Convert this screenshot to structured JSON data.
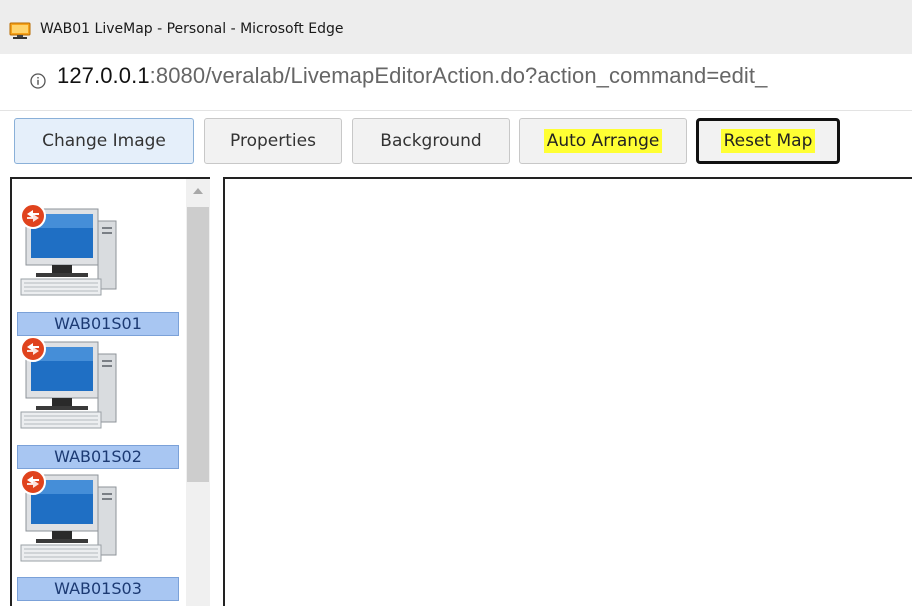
{
  "window": {
    "title": "WAB01 LiveMap - Personal - Microsoft Edge"
  },
  "addressbar": {
    "host": "127.0.0.1",
    "rest": ":8080/veralab/LivemapEditorAction.do?action_command=edit_"
  },
  "toolbar": {
    "change_image": "Change Image",
    "properties": "Properties",
    "background": "Background",
    "auto_arrange": "Auto Arrange",
    "reset_map": "Reset Map"
  },
  "devices": [
    {
      "name": "WAB01S01"
    },
    {
      "name": "WAB01S02"
    },
    {
      "name": "WAB01S03"
    }
  ],
  "colors": {
    "highlight": "#ffff33",
    "label_bg": "#a8c6f2",
    "active_button": "#e5effa"
  }
}
